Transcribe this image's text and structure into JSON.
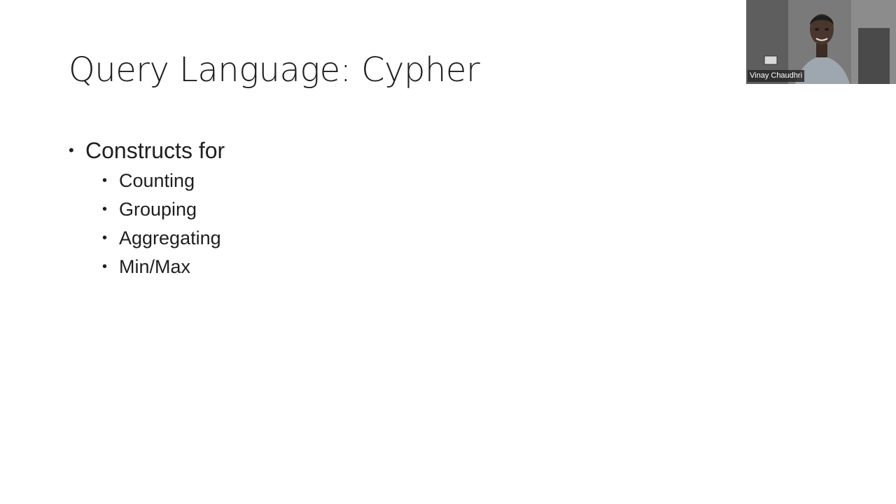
{
  "slide": {
    "title": "Query Language: Cypher",
    "bullet": {
      "label": "Constructs for",
      "sub_items": [
        {
          "label": "Counting"
        },
        {
          "label": "Grouping"
        },
        {
          "label": "Aggregating"
        },
        {
          "label": "Min/Max"
        }
      ]
    },
    "bullet_glyph": "•"
  },
  "video": {
    "participant_name": "Vinay Chaudhri"
  }
}
